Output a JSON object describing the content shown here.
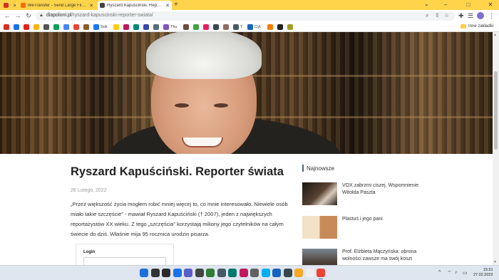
{
  "browser": {
    "tabs": [
      {
        "title": "",
        "favicon_color": "#d93025"
      },
      {
        "title": "WeTransfer - Send Large Files &...",
        "favicon_color": "#ff6a00"
      },
      {
        "title": "Ryszard Kapuściński. Reporter św...",
        "favicon_color": "#444444",
        "active": true
      }
    ],
    "new_tab": "+",
    "window_controls": {
      "minimize": "–",
      "maximize": "□",
      "close": "✕"
    },
    "tab_search": "⌄",
    "nav": {
      "back": "←",
      "forward": "→",
      "reload": "↻"
    },
    "url_domain": "diapoloni.pl",
    "url_path": "/ryszard-kapuscinski-reporter-swiata/",
    "omnibox_icons": {
      "share": "⇪",
      "bookmark": "☆"
    },
    "toolbar_icons": {
      "extensions": "✚",
      "reading_list": "☰",
      "menu": "⋮"
    }
  },
  "bookmarks": {
    "items": [
      {
        "label": "",
        "color": "#d93025"
      },
      {
        "label": "",
        "color": "#1a73e8"
      },
      {
        "label": "",
        "color": "#e62117"
      },
      {
        "label": "",
        "color": "#ffb300"
      },
      {
        "label": "",
        "color": "#555555"
      },
      {
        "label": "",
        "color": "#0f9d58"
      },
      {
        "label": "",
        "color": "#4285f4"
      },
      {
        "label": "",
        "color": "#ea4335"
      },
      {
        "label": "",
        "color": "#8e5b2a"
      },
      {
        "label": "Sok",
        "color": "#1877f2"
      },
      {
        "label": "",
        "color": "#ffcc00"
      },
      {
        "label": "",
        "color": "#c2185b"
      },
      {
        "label": "",
        "color": "#00897b"
      },
      {
        "label": "",
        "color": "#3949ab"
      },
      {
        "label": "",
        "color": "#546e7a"
      },
      {
        "label": "Thu",
        "color": "#7e57c2"
      },
      {
        "label": "",
        "color": "#6d4c41"
      },
      {
        "label": "",
        "color": "#43a047"
      },
      {
        "label": "",
        "color": "#e91e63"
      },
      {
        "label": "",
        "color": "#37474f"
      },
      {
        "label": "",
        "color": "#8d6e63"
      },
      {
        "label": "T",
        "color": "#455a64"
      },
      {
        "label": "Cyt",
        "color": "#1565c0"
      },
      {
        "label": "",
        "color": "#f57c00"
      },
      {
        "label": "",
        "color": "#212121"
      },
      {
        "label": "",
        "color": "#9e9d24"
      }
    ],
    "other": "Inne zakładki"
  },
  "article": {
    "title": "Ryszard Kapuściński. Reporter świata",
    "date": "26 Lutego, 2022",
    "lead": "„Przez większość życia mogłem robić mniej więcej to, co mnie interesowało. Niewiele osób miało takie szczęście” - mawiał Ryszard Kapuściński († 2007), jeden z największych reportażystów XX wieku. Z tego „szczęścia” korzystają miliony jego czytelników na całym świecie do dziś. Właśnie mija 95 rocznica urodzin pisarza."
  },
  "login": {
    "label": "Login",
    "value": ""
  },
  "sidebar": {
    "heading": "Najnowsze",
    "posts": [
      {
        "title": "VOX zabrzmi ciszej. Wspomnienie Witolda Paszta",
        "thumb_color": "#3b2c22"
      },
      {
        "title": "Plastuś i jego pani",
        "thumb_color": "#c9774a"
      },
      {
        "title": "Prof. Elżbieta Mączyńska: obrona wolności zawsze ma swój koszt",
        "thumb_color": "#4a4038"
      }
    ]
  },
  "taskbar": {
    "apps": [
      {
        "name": "start",
        "color": "#1e6fd9"
      },
      {
        "name": "search",
        "color": "#333333"
      },
      {
        "name": "task-view",
        "color": "#2b2b2b"
      },
      {
        "name": "widgets",
        "color": "#1a73e8"
      },
      {
        "name": "chat",
        "color": "#5b5fc7"
      },
      {
        "name": "app-6",
        "color": "#444444"
      },
      {
        "name": "app-7",
        "color": "#2e7d32"
      },
      {
        "name": "app-8",
        "color": "#455a64"
      },
      {
        "name": "app-9",
        "color": "#00796b"
      },
      {
        "name": "app-10",
        "color": "#c2185b"
      },
      {
        "name": "app-11",
        "color": "#616161"
      },
      {
        "name": "skype",
        "color": "#00aff0"
      },
      {
        "name": "app-13",
        "color": "#1565c0"
      },
      {
        "name": "app-14",
        "color": "#37474f"
      },
      {
        "name": "file-explorer",
        "color": "#f9a825"
      },
      {
        "name": "app-16",
        "color": "#eeeeee"
      },
      {
        "name": "chrome",
        "color": "#ea4335",
        "active": true
      }
    ],
    "tray": {
      "chevron": "^",
      "wifi": "⌔",
      "volume": "♪",
      "battery": "▭"
    },
    "time": "15:31",
    "date": "27.02.2022"
  }
}
